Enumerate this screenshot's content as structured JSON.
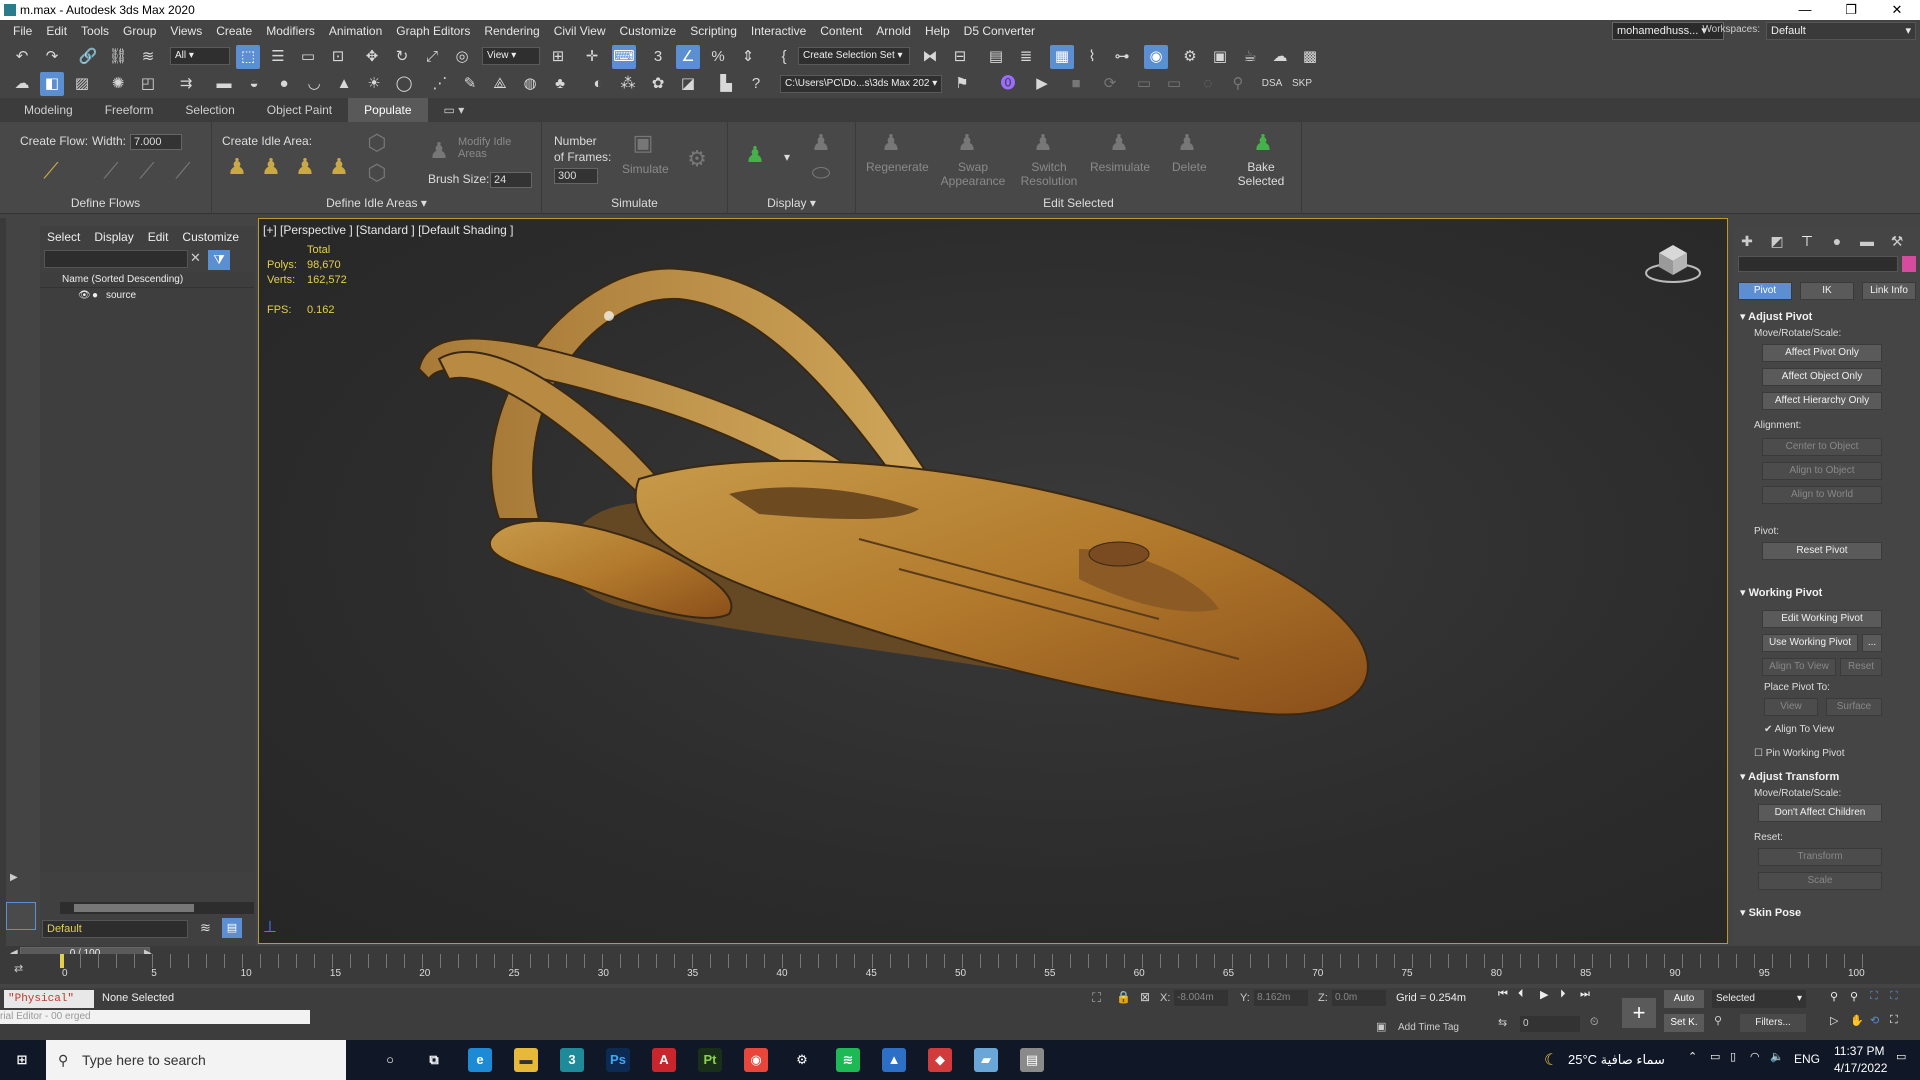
{
  "window": {
    "title": "m.max - Autodesk 3ds Max 2020",
    "min": "—",
    "max": "❐",
    "close": "✕"
  },
  "menu": [
    "File",
    "Edit",
    "Tools",
    "Group",
    "Views",
    "Create",
    "Modifiers",
    "Animation",
    "Graph Editors",
    "Rendering",
    "Civil View",
    "Customize",
    "Scripting",
    "Interactive",
    "Content",
    "Arnold",
    "Help",
    "D5 Converter"
  ],
  "user": {
    "name": "mohamedhuss...",
    "workspaces_label": "Workspaces:",
    "workspace": "Default"
  },
  "toolbar": {
    "filter_all": "All",
    "view_combo": "View",
    "selection_set": "Create Selection Set",
    "path": "C:\\Users\\PC\\Do...s\\3ds Max 202",
    "dsa": "DSA",
    "skp": "SKP"
  },
  "ribbon_tabs": [
    "Modeling",
    "Freeform",
    "Selection",
    "Object Paint",
    "Populate"
  ],
  "ribbon": {
    "create_flow": "Create Flow:",
    "width_label": "Width:",
    "width_value": "7.000",
    "define_flows": "Define Flows",
    "create_idle_area": "Create Idle Area:",
    "modify_idle": "Modify Idle Areas",
    "brush_size_label": "Brush Size:",
    "brush_size": "24",
    "define_idle_areas": "Define Idle Areas ▾",
    "number_of": "Number",
    "of_frames": "of Frames:",
    "frames": "300",
    "simulate_btn": "Simulate",
    "simulate": "Simulate",
    "display": "Display ▾",
    "regenerate": "Regenerate",
    "swap": "Swap Appearance",
    "switch": "Switch Resolution",
    "resimulate": "Resimulate",
    "delete": "Delete",
    "bake": "Bake Selected",
    "edit_selected": "Edit Selected"
  },
  "scene_explorer": {
    "menu": [
      "Select",
      "Display",
      "Edit",
      "Customize"
    ],
    "column": "Name (Sorted Descending)",
    "items": [
      "source"
    ],
    "layer": "Default",
    "frame": "0 / 100"
  },
  "viewport": {
    "label": "[+] [Perspective ] [Standard ] [Default Shading ]",
    "total": "Total",
    "polys_label": "Polys:",
    "polys": "98,670",
    "verts_label": "Verts:",
    "verts": "162,572",
    "fps_label": "FPS:",
    "fps": "0.162"
  },
  "command_panel": {
    "tabs": [
      "Pivot",
      "IK",
      "Link Info"
    ],
    "adjust_pivot": "Adjust Pivot",
    "move_rotate_scale": "Move/Rotate/Scale:",
    "affect_pivot_only": "Affect Pivot Only",
    "affect_object_only": "Affect Object Only",
    "affect_hierarchy_only": "Affect Hierarchy Only",
    "alignment": "Alignment:",
    "center_to_object": "Center to Object",
    "align_to_object": "Align to Object",
    "align_to_world": "Align to World",
    "pivot": "Pivot:",
    "reset_pivot": "Reset Pivot",
    "working_pivot": "Working Pivot",
    "edit_working_pivot": "Edit Working Pivot",
    "use_working_pivot": "Use Working Pivot",
    "ellipsis": "...",
    "align_to_view": "Align To View",
    "reset": "Reset",
    "place_pivot_to": "Place Pivot To:",
    "view": "View",
    "surface": "Surface",
    "align_to_view_check": "Align To View",
    "pin_working_pivot": "Pin Working Pivot",
    "adjust_transform": "Adjust Transform",
    "move_rotate_scale2": "Move/Rotate/Scale:",
    "dont_affect_children": "Don't Affect Children",
    "reset_label": "Reset:",
    "transform": "Transform",
    "scale": "Scale",
    "skin_pose": "Skin Pose"
  },
  "timeline": {
    "ticks": [
      "0",
      "5",
      "10",
      "15",
      "20",
      "25",
      "30",
      "35",
      "40",
      "45",
      "50",
      "55",
      "60",
      "65",
      "70",
      "75",
      "80",
      "85",
      "90",
      "95",
      "100"
    ]
  },
  "status": {
    "physical": "\"Physical\"",
    "none_selected": "None Selected",
    "x_label": "X:",
    "x": "-8.004m",
    "y_label": "Y:",
    "y": "8.162m",
    "z_label": "Z:",
    "z": "0.0m",
    "grid": "Grid = 0.254m",
    "add_time_tag": "Add Time Tag",
    "auto": "Auto",
    "selected": "Selected",
    "set_key": "Set K.",
    "filters": "Filters...",
    "frame_field": "0",
    "script_hint": "rial Editor - 00 erged"
  },
  "taskbar": {
    "search": "Type here to search",
    "weather": "25°C  سماء صافية",
    "lang": "ENG",
    "time": "11:37 PM",
    "date": "4/17/2022"
  }
}
